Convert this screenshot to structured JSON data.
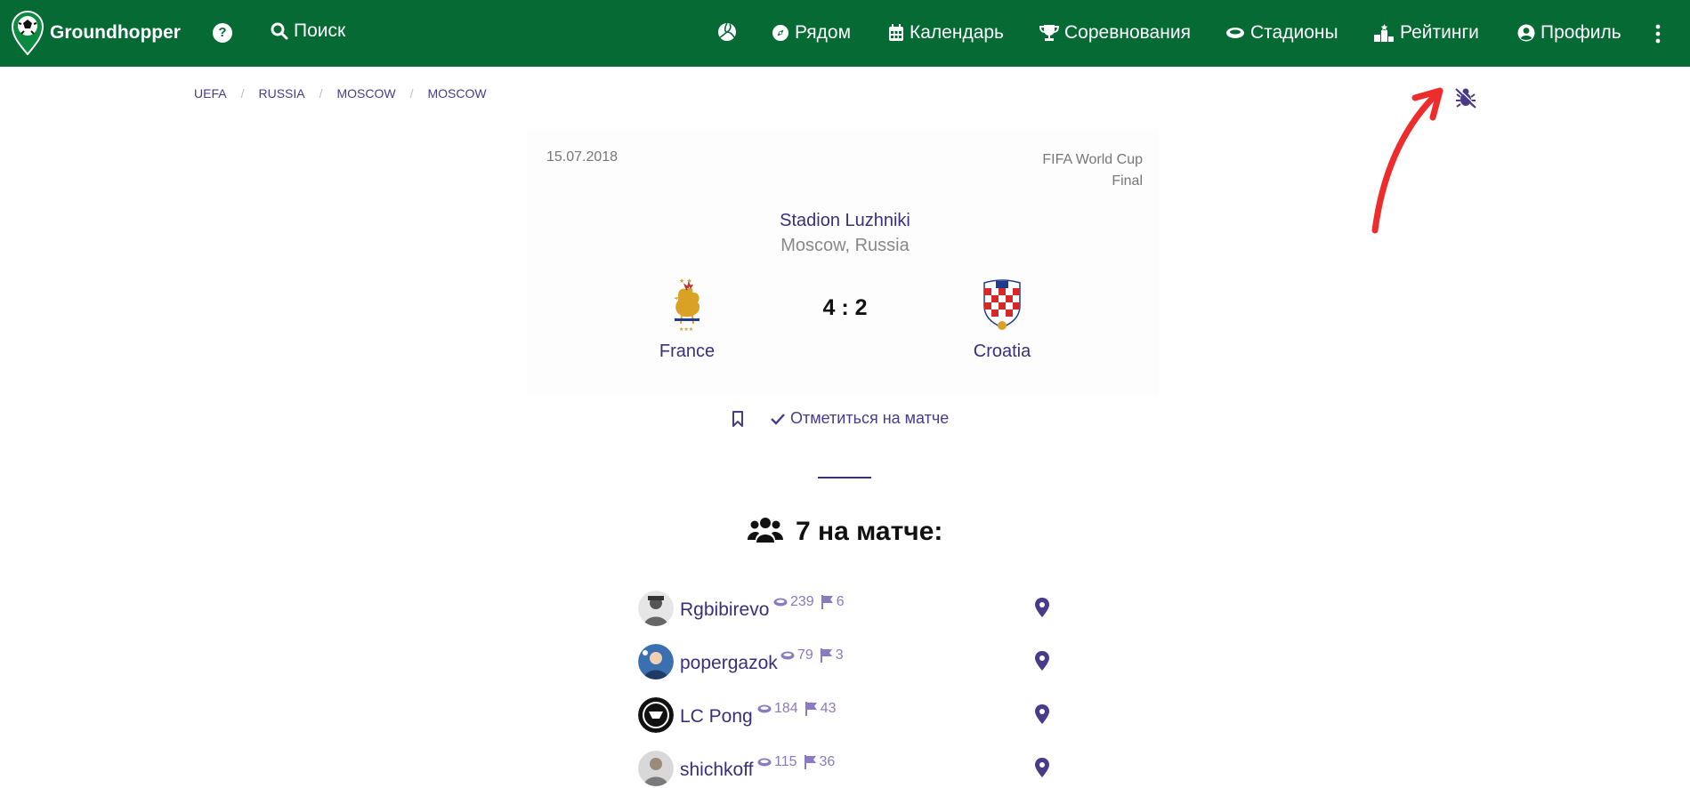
{
  "navbar": {
    "brand": "Groundhopper",
    "help": "?",
    "search": "Поиск",
    "items": [
      {
        "label": "Рядом",
        "icon": "compass-icon"
      },
      {
        "label": "Календарь",
        "icon": "calendar-icon"
      },
      {
        "label": "Соревнования",
        "icon": "trophy-icon"
      },
      {
        "label": "Стадионы",
        "icon": "stadium-icon"
      },
      {
        "label": "Рейтинги",
        "icon": "podium-icon"
      },
      {
        "label": "Профиль",
        "icon": "user-circle-icon"
      }
    ],
    "colors": {
      "bg": "#056a33",
      "accent": "#3b2e7a"
    }
  },
  "breadcrumb": [
    "UEFA",
    "RUSSIA",
    "MOSCOW",
    "MOSCOW"
  ],
  "match": {
    "date": "15.07.2018",
    "competition": "FIFA World Cup",
    "stage": "Final",
    "stadium": "Stadion Luzhniki",
    "city": "Moscow, Russia",
    "home": "France",
    "away": "Croatia",
    "score": "4 : 2"
  },
  "actions": {
    "checkin": "Отметиться на матче"
  },
  "visitors": {
    "title": "7 на матче:",
    "users": [
      {
        "name": "Rgbibirevo",
        "stadiums": "239",
        "countries": "6"
      },
      {
        "name": "popergazok",
        "stadiums": "79",
        "countries": "3"
      },
      {
        "name": "LC Pong",
        "stadiums": "184",
        "countries": "43"
      },
      {
        "name": "shichkoff",
        "stadiums": "115",
        "countries": "36"
      }
    ]
  }
}
